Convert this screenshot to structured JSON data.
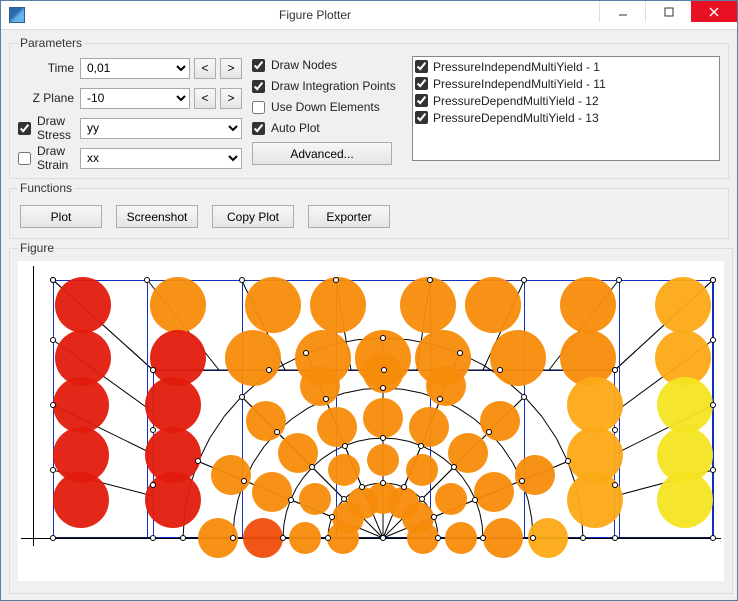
{
  "window": {
    "title": "Figure Plotter",
    "min_tooltip": "Minimize",
    "max_tooltip": "Maximize",
    "close_tooltip": "Close"
  },
  "params": {
    "legend": "Parameters",
    "time_label": "Time",
    "time_value": "0,01",
    "zplane_label": "Z Plane",
    "zplane_value": "-10",
    "prev": "<",
    "next": ">",
    "draw_stress_label": "Draw Stress",
    "draw_stress_checked": true,
    "stress_value": "yy",
    "draw_strain_label": "Draw Strain",
    "draw_strain_checked": false,
    "strain_value": "xx",
    "draw_nodes_label": "Draw Nodes",
    "draw_nodes_checked": true,
    "draw_ip_label": "Draw Integration Points",
    "draw_ip_checked": true,
    "use_down_label": "Use Down Elements",
    "use_down_checked": false,
    "auto_plot_label": "Auto Plot",
    "auto_plot_checked": true,
    "advanced_label": "Advanced...",
    "materials": [
      {
        "label": "PressureIndependMultiYield - 1",
        "checked": true
      },
      {
        "label": "PressureIndependMultiYield - 11",
        "checked": true
      },
      {
        "label": "PressureDependMultiYield - 12",
        "checked": true
      },
      {
        "label": "PressureDependMultiYield - 13",
        "checked": true
      }
    ]
  },
  "functions": {
    "legend": "Functions",
    "plot": "Plot",
    "screenshot": "Screenshot",
    "copy": "Copy Plot",
    "exporter": "Exporter"
  },
  "figure": {
    "legend": "Figure"
  },
  "chart_data": {
    "type": "heatmap",
    "title": "",
    "xlabel": "",
    "ylabel": "",
    "x_range": [
      -1,
      1
    ],
    "y_range": [
      0,
      1
    ],
    "note": "Radial half-disc mesh; integration-point circles colored by stress yy magnitude",
    "color_scale": {
      "low": "#f6e422",
      "mid": "#f78c0b",
      "high": "#e21b0c",
      "meaning": "relative |stress_yy| (yellow=low, red=high)"
    },
    "outer_box_nodes_x": [
      -1.0,
      -0.71,
      -0.43,
      -0.14,
      0.14,
      0.43,
      0.71,
      1.0
    ],
    "inner_box_nodes_x": [
      -0.7,
      -0.35,
      0.0,
      0.35,
      0.7
    ],
    "top_row_stress": [
      0.85,
      0.6,
      0.5,
      0.5,
      0.5,
      0.5,
      0.5,
      0.3
    ],
    "second_row_stress": [
      0.9,
      0.9,
      0.55,
      0.55,
      0.55,
      0.55,
      0.55,
      0.35
    ],
    "left_col_stress": [
      0.85,
      0.9,
      0.95,
      0.95,
      0.9
    ],
    "right_col_stress": [
      0.3,
      0.3,
      0.2,
      0.2,
      0.2
    ],
    "arc_outer_stress": [
      0.6,
      0.55,
      0.55,
      0.55,
      0.55,
      0.5,
      0.5,
      0.45,
      0.4
    ],
    "arc_inner_stress": [
      0.65,
      0.6,
      0.6,
      0.6,
      0.6,
      0.55,
      0.55,
      0.5,
      0.45
    ],
    "center_bottom_stress": [
      0.55,
      0.55,
      0.55,
      0.55,
      0.55
    ]
  }
}
